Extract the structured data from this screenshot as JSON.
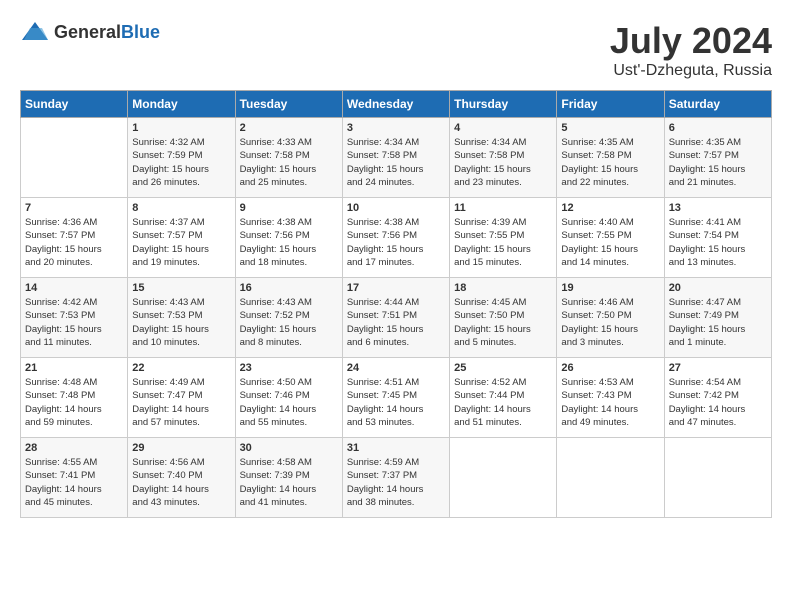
{
  "header": {
    "logo_general": "General",
    "logo_blue": "Blue",
    "month_title": "July 2024",
    "location": "Ust'-Dzheguta, Russia"
  },
  "days_of_week": [
    "Sunday",
    "Monday",
    "Tuesday",
    "Wednesday",
    "Thursday",
    "Friday",
    "Saturday"
  ],
  "weeks": [
    [
      {
        "day": "",
        "sunrise": "",
        "sunset": "",
        "daylight": ""
      },
      {
        "day": "1",
        "sunrise": "Sunrise: 4:32 AM",
        "sunset": "Sunset: 7:59 PM",
        "daylight": "Daylight: 15 hours and 26 minutes."
      },
      {
        "day": "2",
        "sunrise": "Sunrise: 4:33 AM",
        "sunset": "Sunset: 7:58 PM",
        "daylight": "Daylight: 15 hours and 25 minutes."
      },
      {
        "day": "3",
        "sunrise": "Sunrise: 4:34 AM",
        "sunset": "Sunset: 7:58 PM",
        "daylight": "Daylight: 15 hours and 24 minutes."
      },
      {
        "day": "4",
        "sunrise": "Sunrise: 4:34 AM",
        "sunset": "Sunset: 7:58 PM",
        "daylight": "Daylight: 15 hours and 23 minutes."
      },
      {
        "day": "5",
        "sunrise": "Sunrise: 4:35 AM",
        "sunset": "Sunset: 7:58 PM",
        "daylight": "Daylight: 15 hours and 22 minutes."
      },
      {
        "day": "6",
        "sunrise": "Sunrise: 4:35 AM",
        "sunset": "Sunset: 7:57 PM",
        "daylight": "Daylight: 15 hours and 21 minutes."
      }
    ],
    [
      {
        "day": "7",
        "sunrise": "Sunrise: 4:36 AM",
        "sunset": "Sunset: 7:57 PM",
        "daylight": "Daylight: 15 hours and 20 minutes."
      },
      {
        "day": "8",
        "sunrise": "Sunrise: 4:37 AM",
        "sunset": "Sunset: 7:57 PM",
        "daylight": "Daylight: 15 hours and 19 minutes."
      },
      {
        "day": "9",
        "sunrise": "Sunrise: 4:38 AM",
        "sunset": "Sunset: 7:56 PM",
        "daylight": "Daylight: 15 hours and 18 minutes."
      },
      {
        "day": "10",
        "sunrise": "Sunrise: 4:38 AM",
        "sunset": "Sunset: 7:56 PM",
        "daylight": "Daylight: 15 hours and 17 minutes."
      },
      {
        "day": "11",
        "sunrise": "Sunrise: 4:39 AM",
        "sunset": "Sunset: 7:55 PM",
        "daylight": "Daylight: 15 hours and 15 minutes."
      },
      {
        "day": "12",
        "sunrise": "Sunrise: 4:40 AM",
        "sunset": "Sunset: 7:55 PM",
        "daylight": "Daylight: 15 hours and 14 minutes."
      },
      {
        "day": "13",
        "sunrise": "Sunrise: 4:41 AM",
        "sunset": "Sunset: 7:54 PM",
        "daylight": "Daylight: 15 hours and 13 minutes."
      }
    ],
    [
      {
        "day": "14",
        "sunrise": "Sunrise: 4:42 AM",
        "sunset": "Sunset: 7:53 PM",
        "daylight": "Daylight: 15 hours and 11 minutes."
      },
      {
        "day": "15",
        "sunrise": "Sunrise: 4:43 AM",
        "sunset": "Sunset: 7:53 PM",
        "daylight": "Daylight: 15 hours and 10 minutes."
      },
      {
        "day": "16",
        "sunrise": "Sunrise: 4:43 AM",
        "sunset": "Sunset: 7:52 PM",
        "daylight": "Daylight: 15 hours and 8 minutes."
      },
      {
        "day": "17",
        "sunrise": "Sunrise: 4:44 AM",
        "sunset": "Sunset: 7:51 PM",
        "daylight": "Daylight: 15 hours and 6 minutes."
      },
      {
        "day": "18",
        "sunrise": "Sunrise: 4:45 AM",
        "sunset": "Sunset: 7:50 PM",
        "daylight": "Daylight: 15 hours and 5 minutes."
      },
      {
        "day": "19",
        "sunrise": "Sunrise: 4:46 AM",
        "sunset": "Sunset: 7:50 PM",
        "daylight": "Daylight: 15 hours and 3 minutes."
      },
      {
        "day": "20",
        "sunrise": "Sunrise: 4:47 AM",
        "sunset": "Sunset: 7:49 PM",
        "daylight": "Daylight: 15 hours and 1 minute."
      }
    ],
    [
      {
        "day": "21",
        "sunrise": "Sunrise: 4:48 AM",
        "sunset": "Sunset: 7:48 PM",
        "daylight": "Daylight: 14 hours and 59 minutes."
      },
      {
        "day": "22",
        "sunrise": "Sunrise: 4:49 AM",
        "sunset": "Sunset: 7:47 PM",
        "daylight": "Daylight: 14 hours and 57 minutes."
      },
      {
        "day": "23",
        "sunrise": "Sunrise: 4:50 AM",
        "sunset": "Sunset: 7:46 PM",
        "daylight": "Daylight: 14 hours and 55 minutes."
      },
      {
        "day": "24",
        "sunrise": "Sunrise: 4:51 AM",
        "sunset": "Sunset: 7:45 PM",
        "daylight": "Daylight: 14 hours and 53 minutes."
      },
      {
        "day": "25",
        "sunrise": "Sunrise: 4:52 AM",
        "sunset": "Sunset: 7:44 PM",
        "daylight": "Daylight: 14 hours and 51 minutes."
      },
      {
        "day": "26",
        "sunrise": "Sunrise: 4:53 AM",
        "sunset": "Sunset: 7:43 PM",
        "daylight": "Daylight: 14 hours and 49 minutes."
      },
      {
        "day": "27",
        "sunrise": "Sunrise: 4:54 AM",
        "sunset": "Sunset: 7:42 PM",
        "daylight": "Daylight: 14 hours and 47 minutes."
      }
    ],
    [
      {
        "day": "28",
        "sunrise": "Sunrise: 4:55 AM",
        "sunset": "Sunset: 7:41 PM",
        "daylight": "Daylight: 14 hours and 45 minutes."
      },
      {
        "day": "29",
        "sunrise": "Sunrise: 4:56 AM",
        "sunset": "Sunset: 7:40 PM",
        "daylight": "Daylight: 14 hours and 43 minutes."
      },
      {
        "day": "30",
        "sunrise": "Sunrise: 4:58 AM",
        "sunset": "Sunset: 7:39 PM",
        "daylight": "Daylight: 14 hours and 41 minutes."
      },
      {
        "day": "31",
        "sunrise": "Sunrise: 4:59 AM",
        "sunset": "Sunset: 7:37 PM",
        "daylight": "Daylight: 14 hours and 38 minutes."
      },
      {
        "day": "",
        "sunrise": "",
        "sunset": "",
        "daylight": ""
      },
      {
        "day": "",
        "sunrise": "",
        "sunset": "",
        "daylight": ""
      },
      {
        "day": "",
        "sunrise": "",
        "sunset": "",
        "daylight": ""
      }
    ]
  ]
}
